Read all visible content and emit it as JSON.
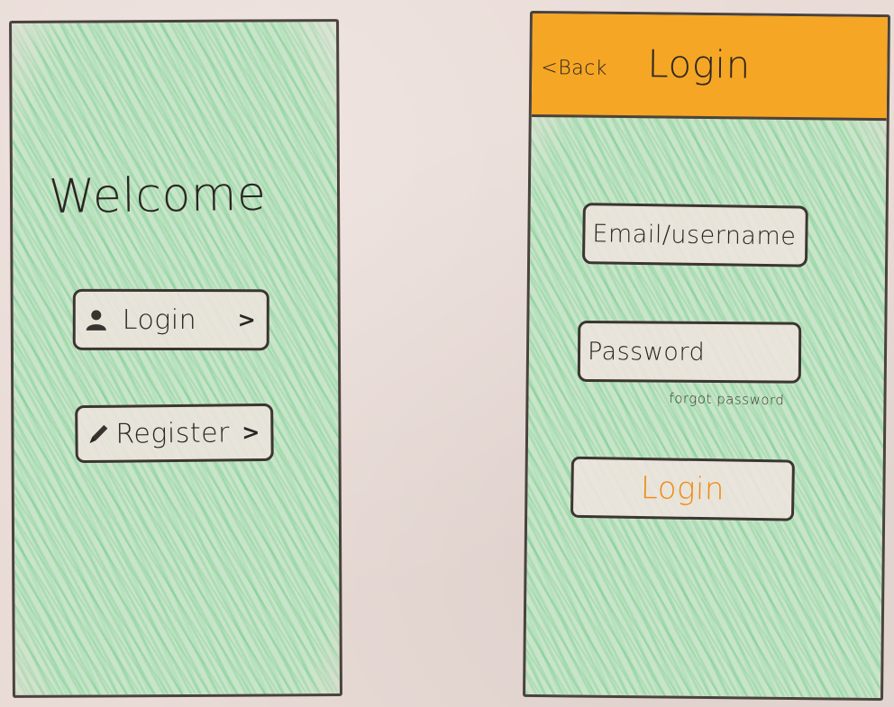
{
  "welcome_screen": {
    "title": "Welcome",
    "login_button": {
      "label": "Login",
      "icon": "user-icon",
      "chevron": ">"
    },
    "register_button": {
      "label": "Register",
      "icon": "pencil-icon",
      "chevron": ">"
    },
    "background_color": "#c9e5c9"
  },
  "login_screen": {
    "header": {
      "back_label": "<Back",
      "title": "Login",
      "background_color": "#f5a624"
    },
    "email_field": {
      "placeholder": "Email/username"
    },
    "password_field": {
      "placeholder": "Password"
    },
    "forgot_password_label": "forgot password",
    "submit_button": {
      "label": "Login",
      "color": "#f08a12"
    },
    "background_color": "#c9e5c9"
  }
}
